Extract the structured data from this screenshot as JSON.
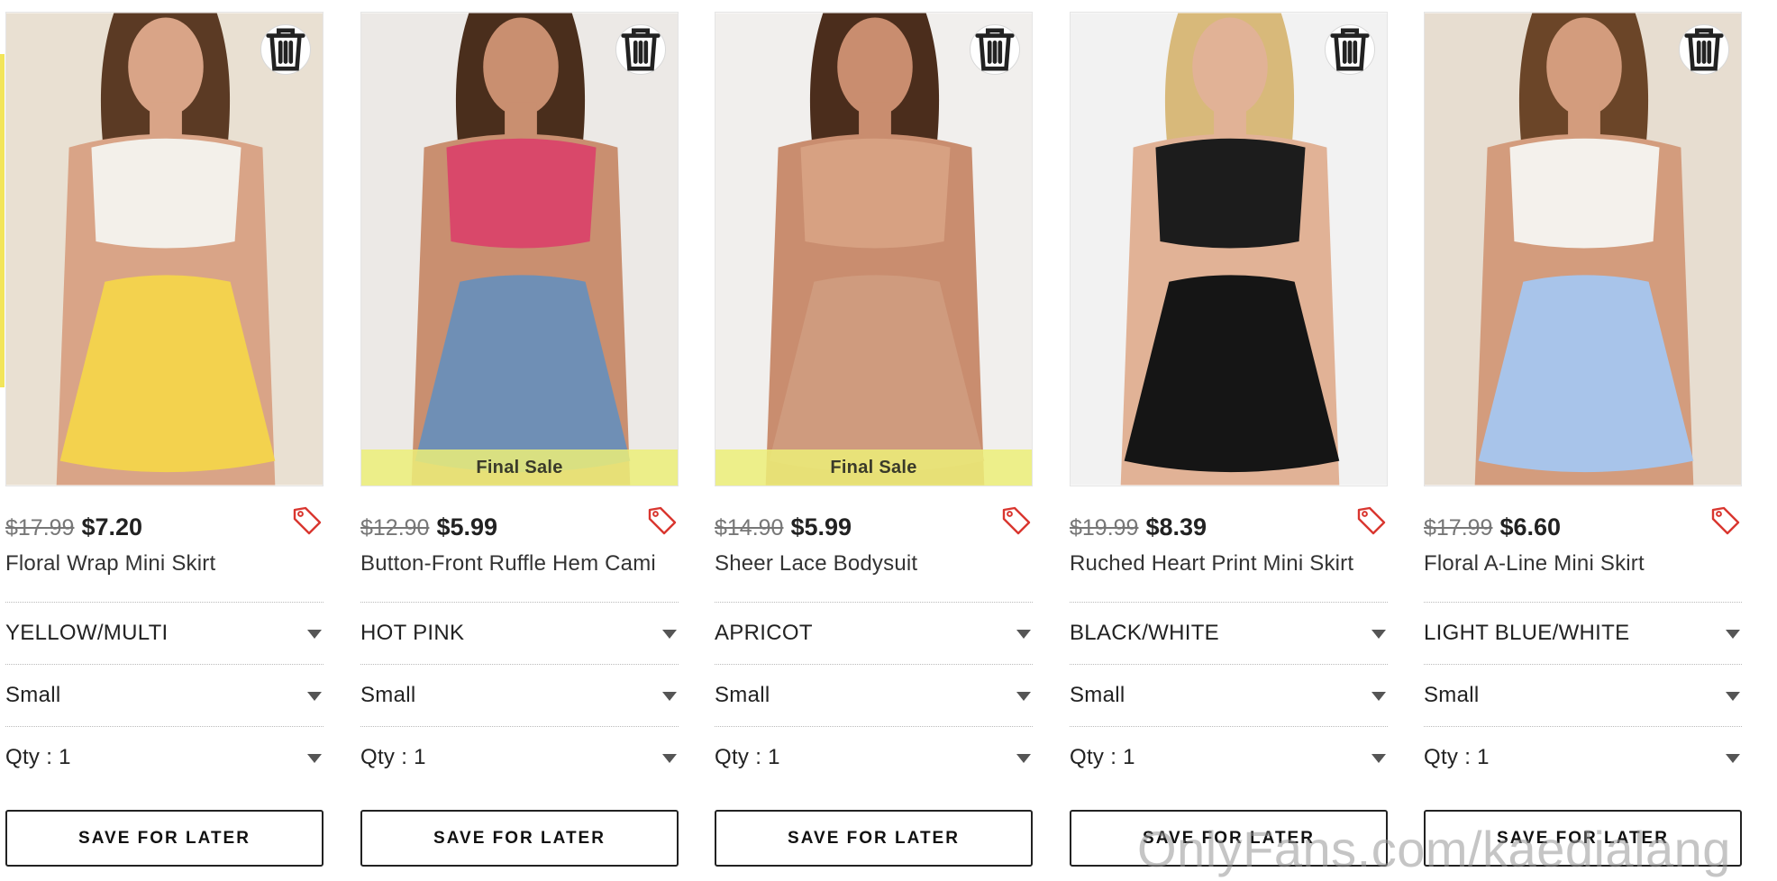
{
  "products": [
    {
      "old_price": "$17.99",
      "price": "$7.20",
      "name": "Floral Wrap Mini Skirt",
      "color": "YELLOW/MULTI",
      "size": "Small",
      "qty": "Qty : 1",
      "final_sale": "",
      "save_label": "SAVE FOR LATER",
      "palette": {
        "bg": "#e9e0d2",
        "skin": "#d9a487",
        "hair": "#5b3a24",
        "top": "#f3f0ea",
        "bottom": "#f3d24e"
      }
    },
    {
      "old_price": "$12.90",
      "price": "$5.99",
      "name": "Button-Front Ruffle Hem Cami",
      "color": "HOT PINK",
      "size": "Small",
      "qty": "Qty : 1",
      "final_sale": "Final Sale",
      "save_label": "SAVE FOR LATER",
      "palette": {
        "bg": "#ece9e6",
        "skin": "#c98f70",
        "hair": "#4a2e1c",
        "top": "#d9486a",
        "bottom": "#6f8fb5"
      }
    },
    {
      "old_price": "$14.90",
      "price": "$5.99",
      "name": "Sheer Lace Bodysuit",
      "color": "APRICOT",
      "size": "Small",
      "qty": "Qty : 1",
      "final_sale": "Final Sale",
      "save_label": "SAVE FOR LATER",
      "palette": {
        "bg": "#f1efed",
        "skin": "#c98d6f",
        "hair": "#4b2d1c",
        "top": "#d7a182",
        "bottom": "#cf9b7e"
      }
    },
    {
      "old_price": "$19.99",
      "price": "$8.39",
      "name": "Ruched Heart Print Mini Skirt",
      "color": "BLACK/WHITE",
      "size": "Small",
      "qty": "Qty : 1",
      "final_sale": "",
      "save_label": "SAVE FOR LATER",
      "palette": {
        "bg": "#f2f2f2",
        "skin": "#e1b296",
        "hair": "#d8b97a",
        "top": "#1c1c1c",
        "bottom": "#151515"
      }
    },
    {
      "old_price": "$17.99",
      "price": "$6.60",
      "name": "Floral A-Line Mini Skirt",
      "color": "LIGHT BLUE/WHITE",
      "size": "Small",
      "qty": "Qty : 1",
      "final_sale": "",
      "save_label": "SAVE FOR LATER",
      "palette": {
        "bg": "#e7ddd0",
        "skin": "#d39c7d",
        "hair": "#6b4528",
        "top": "#f4f1ec",
        "bottom": "#a8c4ea"
      }
    }
  ],
  "watermark": "OnlyFans.com/kaedialang",
  "icons": {
    "delete": "trash-icon",
    "tag": "price-tag-icon",
    "dropdown": "chevron-down-icon"
  }
}
